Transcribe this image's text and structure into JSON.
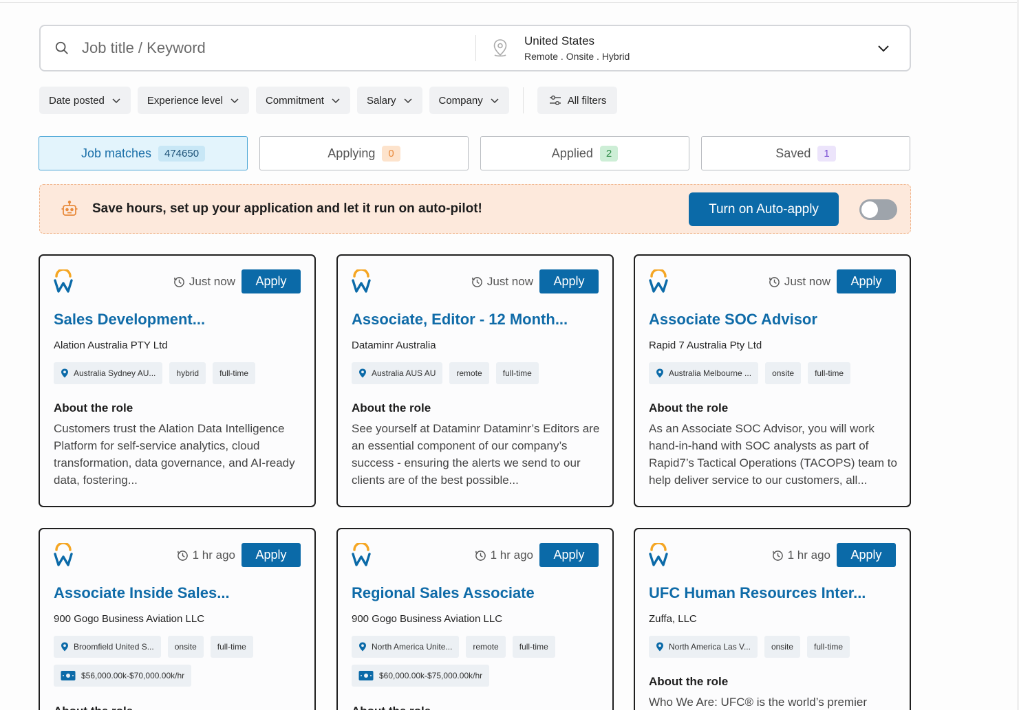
{
  "search": {
    "keyword_placeholder": "Job title / Keyword",
    "location": "United States",
    "work_types": "Remote . Onsite . Hybrid"
  },
  "filters": {
    "date_posted": "Date posted",
    "experience_level": "Experience level",
    "commitment": "Commitment",
    "salary": "Salary",
    "company": "Company",
    "all_filters": "All filters"
  },
  "tabs": [
    {
      "label": "Job matches",
      "count": "474650"
    },
    {
      "label": "Applying",
      "count": "0"
    },
    {
      "label": "Applied",
      "count": "2"
    },
    {
      "label": "Saved",
      "count": "1"
    }
  ],
  "banner": {
    "text": "Save hours, set up your application and let it run on auto-pilot!",
    "button": "Turn on Auto-apply"
  },
  "colors": {
    "accent": "#0b6aa8",
    "title": "#0f6ba8",
    "banner_bg": "#fde9dc",
    "logo_orange": "#f5a623",
    "logo_blue": "#0b6aa8"
  },
  "jobs": [
    {
      "time": "Just now",
      "apply": "Apply",
      "title": "Sales Development...",
      "company": "Alation Australia PTY Ltd",
      "location": "Australia Sydney AU...",
      "mode": "hybrid",
      "type": "full-time",
      "about_heading": "About the role",
      "about": "Customers trust the Alation Data Intelligence Platform for self-service analytics, cloud transformation, data governance, and AI-ready data, fostering..."
    },
    {
      "time": "Just now",
      "apply": "Apply",
      "title": "Associate, Editor - 12 Month...",
      "company": "Dataminr Australia",
      "location": "Australia AUS AU",
      "mode": "remote",
      "type": "full-time",
      "about_heading": "About the role",
      "about": "See yourself at Dataminr Dataminr’s Editors are an essential component of our company’s success - ensuring the alerts we send to our clients are of the best possible..."
    },
    {
      "time": "Just now",
      "apply": "Apply",
      "title": "Associate SOC Advisor",
      "company": "Rapid 7 Australia Pty Ltd",
      "location": "Australia Melbourne ...",
      "mode": "onsite",
      "type": "full-time",
      "about_heading": "About the role",
      "about": "As an Associate SOC Advisor, you will work hand-in-hand with SOC analysts as part of Rapid7’s Tactical Operations (TACOPS) team to help deliver service to our customers, all..."
    },
    {
      "time": "1 hr ago",
      "apply": "Apply",
      "title": "Associate Inside Sales...",
      "company": "900 Gogo Business Aviation LLC",
      "location": "Broomfield United S...",
      "mode": "onsite",
      "type": "full-time",
      "salary": "$56,000.00k-$70,000.00k/hr",
      "about_heading": "About the role",
      "about": ""
    },
    {
      "time": "1 hr ago",
      "apply": "Apply",
      "title": "Regional Sales Associate",
      "company": "900 Gogo Business Aviation LLC",
      "location": "North America Unite...",
      "mode": "remote",
      "type": "full-time",
      "salary": "$60,000.00k-$75,000.00k/hr",
      "about_heading": "About the role",
      "about": ""
    },
    {
      "time": "1 hr ago",
      "apply": "Apply",
      "title": "UFC Human Resources Inter...",
      "company": "Zuffa, LLC",
      "location": "North America Las V...",
      "mode": "onsite",
      "type": "full-time",
      "about_heading": "About the role",
      "about": "Who We Are: UFC® is the world’s premier"
    }
  ]
}
